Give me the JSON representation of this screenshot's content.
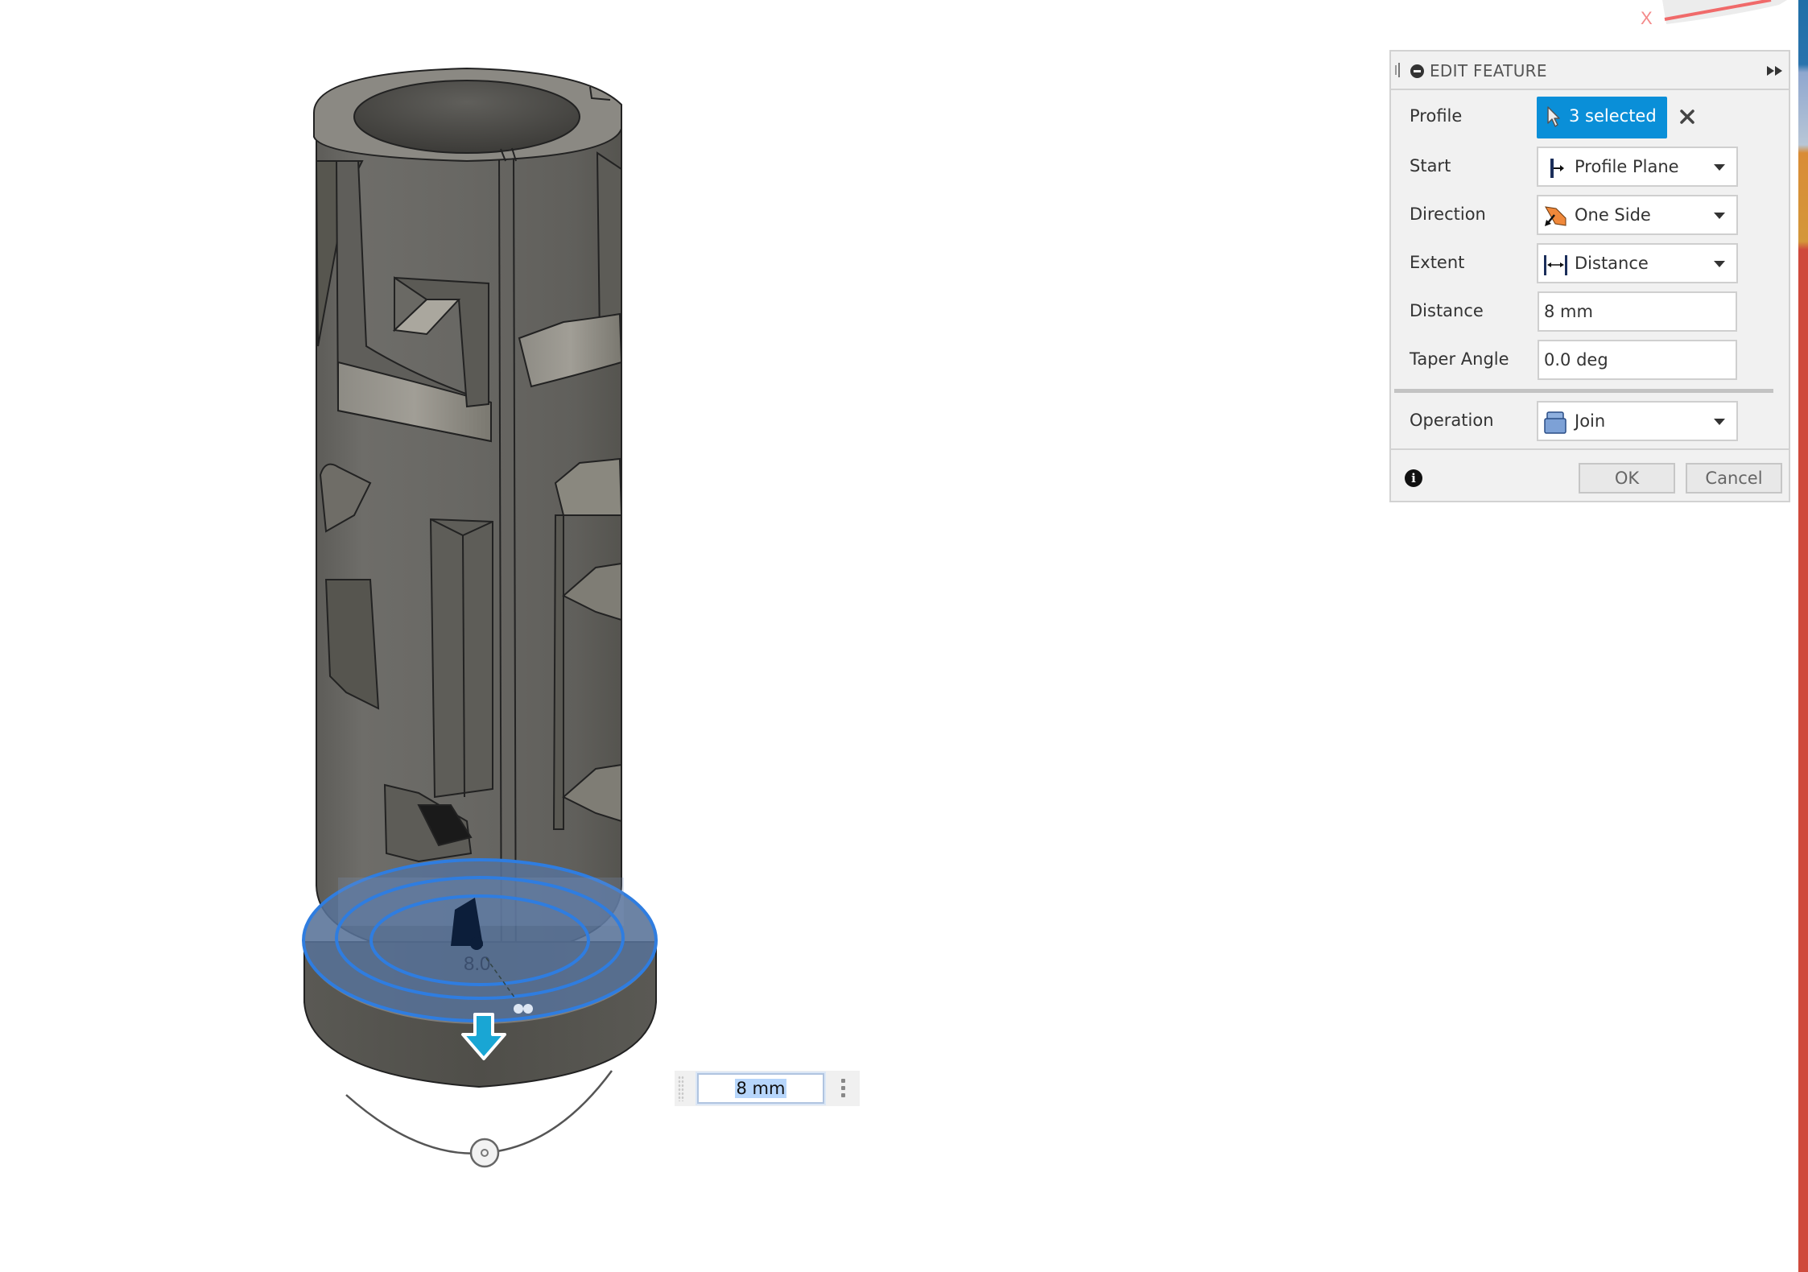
{
  "viewcube": {
    "axis_label": "X",
    "axis_color": "#f06a6a"
  },
  "panel": {
    "title": "EDIT FEATURE",
    "rows": {
      "profile": {
        "label": "Profile",
        "value": "3 selected",
        "icon": "cursor-arrow-icon",
        "clear_icon": "close-x-icon",
        "accent": "#0a8fd8"
      },
      "start": {
        "label": "Start",
        "value": "Profile Plane",
        "icon": "profile-plane-icon"
      },
      "direction": {
        "label": "Direction",
        "value": "One Side",
        "icon": "one-side-direction-icon"
      },
      "extent": {
        "label": "Extent",
        "value": "Distance",
        "icon": "distance-extent-icon"
      },
      "distance": {
        "label": "Distance",
        "value": "8 mm"
      },
      "taper": {
        "label": "Taper Angle",
        "value": "0.0 deg"
      },
      "operation": {
        "label": "Operation",
        "value": "Join",
        "icon": "join-operation-icon"
      }
    },
    "footer": {
      "info_glyph": "i",
      "ok_label": "OK",
      "cancel_label": "Cancel"
    }
  },
  "canvas": {
    "distance_input_value": "8 mm",
    "sketch_dimension_label": "8.0",
    "manipulator": "extrude-direction-arrow",
    "selection_color": "#2f7de0"
  }
}
